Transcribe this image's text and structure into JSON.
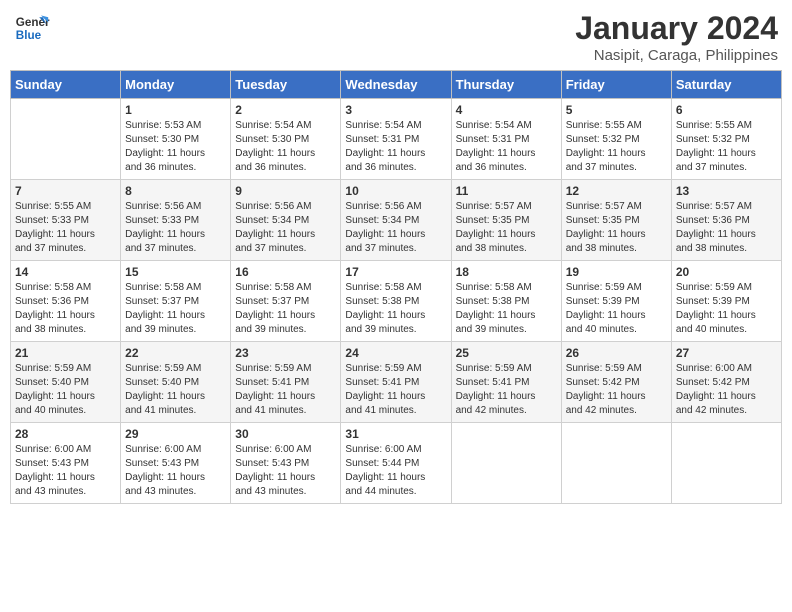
{
  "logo": {
    "text_general": "General",
    "text_blue": "Blue"
  },
  "title": "January 2024",
  "subtitle": "Nasipit, Caraga, Philippines",
  "days_of_week": [
    "Sunday",
    "Monday",
    "Tuesday",
    "Wednesday",
    "Thursday",
    "Friday",
    "Saturday"
  ],
  "weeks": [
    [
      {
        "day": "",
        "info": ""
      },
      {
        "day": "1",
        "info": "Sunrise: 5:53 AM\nSunset: 5:30 PM\nDaylight: 11 hours\nand 36 minutes."
      },
      {
        "day": "2",
        "info": "Sunrise: 5:54 AM\nSunset: 5:30 PM\nDaylight: 11 hours\nand 36 minutes."
      },
      {
        "day": "3",
        "info": "Sunrise: 5:54 AM\nSunset: 5:31 PM\nDaylight: 11 hours\nand 36 minutes."
      },
      {
        "day": "4",
        "info": "Sunrise: 5:54 AM\nSunset: 5:31 PM\nDaylight: 11 hours\nand 36 minutes."
      },
      {
        "day": "5",
        "info": "Sunrise: 5:55 AM\nSunset: 5:32 PM\nDaylight: 11 hours\nand 37 minutes."
      },
      {
        "day": "6",
        "info": "Sunrise: 5:55 AM\nSunset: 5:32 PM\nDaylight: 11 hours\nand 37 minutes."
      }
    ],
    [
      {
        "day": "7",
        "info": "Sunrise: 5:55 AM\nSunset: 5:33 PM\nDaylight: 11 hours\nand 37 minutes."
      },
      {
        "day": "8",
        "info": "Sunrise: 5:56 AM\nSunset: 5:33 PM\nDaylight: 11 hours\nand 37 minutes."
      },
      {
        "day": "9",
        "info": "Sunrise: 5:56 AM\nSunset: 5:34 PM\nDaylight: 11 hours\nand 37 minutes."
      },
      {
        "day": "10",
        "info": "Sunrise: 5:56 AM\nSunset: 5:34 PM\nDaylight: 11 hours\nand 37 minutes."
      },
      {
        "day": "11",
        "info": "Sunrise: 5:57 AM\nSunset: 5:35 PM\nDaylight: 11 hours\nand 38 minutes."
      },
      {
        "day": "12",
        "info": "Sunrise: 5:57 AM\nSunset: 5:35 PM\nDaylight: 11 hours\nand 38 minutes."
      },
      {
        "day": "13",
        "info": "Sunrise: 5:57 AM\nSunset: 5:36 PM\nDaylight: 11 hours\nand 38 minutes."
      }
    ],
    [
      {
        "day": "14",
        "info": "Sunrise: 5:58 AM\nSunset: 5:36 PM\nDaylight: 11 hours\nand 38 minutes."
      },
      {
        "day": "15",
        "info": "Sunrise: 5:58 AM\nSunset: 5:37 PM\nDaylight: 11 hours\nand 39 minutes."
      },
      {
        "day": "16",
        "info": "Sunrise: 5:58 AM\nSunset: 5:37 PM\nDaylight: 11 hours\nand 39 minutes."
      },
      {
        "day": "17",
        "info": "Sunrise: 5:58 AM\nSunset: 5:38 PM\nDaylight: 11 hours\nand 39 minutes."
      },
      {
        "day": "18",
        "info": "Sunrise: 5:58 AM\nSunset: 5:38 PM\nDaylight: 11 hours\nand 39 minutes."
      },
      {
        "day": "19",
        "info": "Sunrise: 5:59 AM\nSunset: 5:39 PM\nDaylight: 11 hours\nand 40 minutes."
      },
      {
        "day": "20",
        "info": "Sunrise: 5:59 AM\nSunset: 5:39 PM\nDaylight: 11 hours\nand 40 minutes."
      }
    ],
    [
      {
        "day": "21",
        "info": "Sunrise: 5:59 AM\nSunset: 5:40 PM\nDaylight: 11 hours\nand 40 minutes."
      },
      {
        "day": "22",
        "info": "Sunrise: 5:59 AM\nSunset: 5:40 PM\nDaylight: 11 hours\nand 41 minutes."
      },
      {
        "day": "23",
        "info": "Sunrise: 5:59 AM\nSunset: 5:41 PM\nDaylight: 11 hours\nand 41 minutes."
      },
      {
        "day": "24",
        "info": "Sunrise: 5:59 AM\nSunset: 5:41 PM\nDaylight: 11 hours\nand 41 minutes."
      },
      {
        "day": "25",
        "info": "Sunrise: 5:59 AM\nSunset: 5:41 PM\nDaylight: 11 hours\nand 42 minutes."
      },
      {
        "day": "26",
        "info": "Sunrise: 5:59 AM\nSunset: 5:42 PM\nDaylight: 11 hours\nand 42 minutes."
      },
      {
        "day": "27",
        "info": "Sunrise: 6:00 AM\nSunset: 5:42 PM\nDaylight: 11 hours\nand 42 minutes."
      }
    ],
    [
      {
        "day": "28",
        "info": "Sunrise: 6:00 AM\nSunset: 5:43 PM\nDaylight: 11 hours\nand 43 minutes."
      },
      {
        "day": "29",
        "info": "Sunrise: 6:00 AM\nSunset: 5:43 PM\nDaylight: 11 hours\nand 43 minutes."
      },
      {
        "day": "30",
        "info": "Sunrise: 6:00 AM\nSunset: 5:43 PM\nDaylight: 11 hours\nand 43 minutes."
      },
      {
        "day": "31",
        "info": "Sunrise: 6:00 AM\nSunset: 5:44 PM\nDaylight: 11 hours\nand 44 minutes."
      },
      {
        "day": "",
        "info": ""
      },
      {
        "day": "",
        "info": ""
      },
      {
        "day": "",
        "info": ""
      }
    ]
  ]
}
